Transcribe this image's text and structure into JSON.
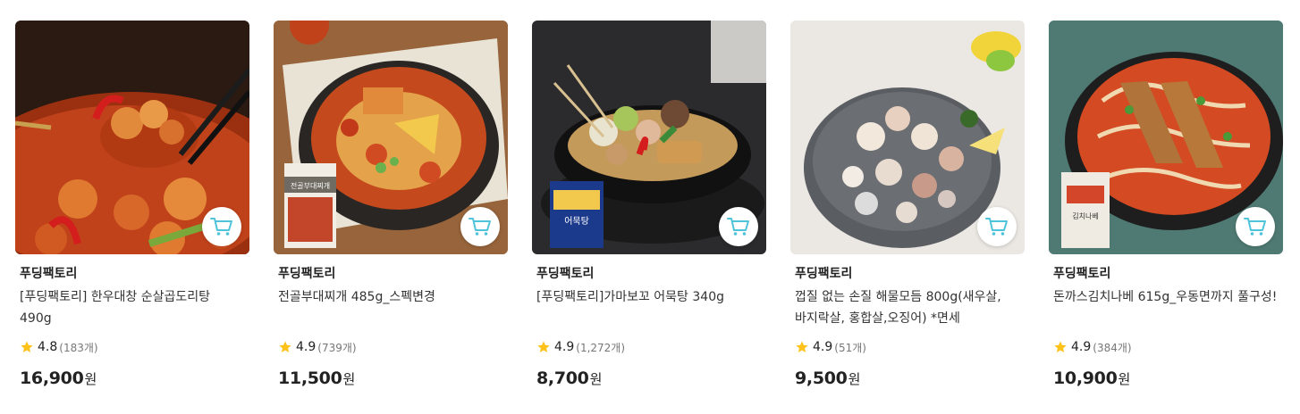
{
  "products": [
    {
      "brand": "푸딩팩토리",
      "name": "[푸딩팩토리] 한우대창 순살곱도리탕 490g",
      "score": "4.8",
      "count": "(183개)",
      "price": "16,900",
      "currency": "원",
      "image": "spicy-braised-chicken-photo"
    },
    {
      "brand": "푸딩팩토리",
      "name": "전골부대찌개 485g_스펙변경",
      "score": "4.9",
      "count": "(739개)",
      "price": "11,500",
      "currency": "원",
      "image": "budae-jjigae-photo",
      "package_text": "전골부대찌개"
    },
    {
      "brand": "푸딩팩토리",
      "name": "[푸딩팩토리]가마보꼬 어묵탕 340g",
      "score": "4.9",
      "count": "(1,272개)",
      "price": "8,700",
      "currency": "원",
      "image": "fishcake-soup-photo",
      "package_text": "어묵탕"
    },
    {
      "brand": "푸딩팩토리",
      "name": "껍질 없는 손질 해물모듬 800g(새우살,바지락살, 홍합살,오징어) *면세",
      "score": "4.9",
      "count": "(51개)",
      "price": "9,500",
      "currency": "원",
      "image": "seafood-mix-photo"
    },
    {
      "brand": "푸딩팩토리",
      "name": "돈까스김치나베 615g_우동면까지 풀구성!",
      "score": "4.9",
      "count": "(384개)",
      "price": "10,900",
      "currency": "원",
      "image": "tonkatsu-kimchi-nabe-photo",
      "package_text": "김치나베"
    }
  ],
  "colors": {
    "cart_icon": "#4fc3d9",
    "star": "#ffc21a"
  },
  "icons": {
    "cart": "cart-icon",
    "star": "star-icon"
  }
}
